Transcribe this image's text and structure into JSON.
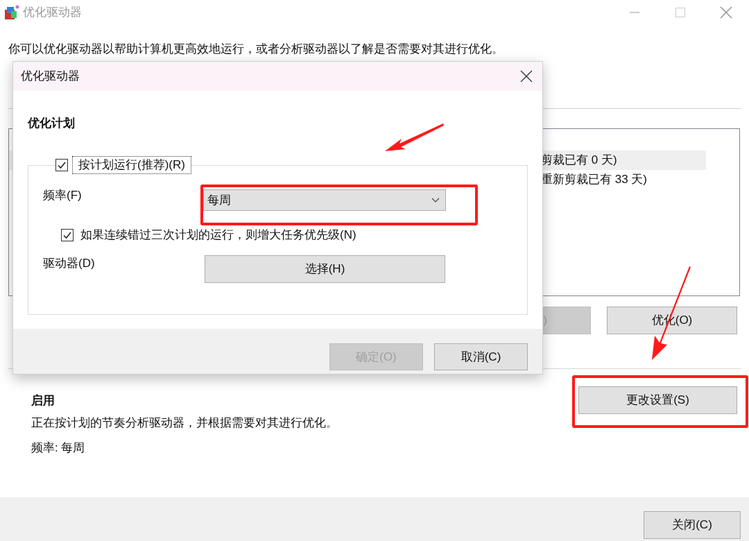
{
  "window": {
    "title": "优化驱动器",
    "description": "你可以优化驱动器以帮助计算机更高效地运行，或者分析驱动器以了解是否需要对其进行优化。"
  },
  "drive_list": {
    "rows": [
      {
        "text": "剪裁已有 0 天)",
        "selected": true
      },
      {
        "text": "重新剪裁已有 33 天)",
        "selected": false
      }
    ]
  },
  "drive_buttons": [
    {
      "label": ")",
      "disabled": true
    },
    {
      "label": "优化(O)",
      "disabled": false
    }
  ],
  "scheduled_optimization": {
    "status": "启用",
    "description": "正在按计划的节奏分析驱动器，并根据需要对其进行优化。",
    "frequency": "频率: 每周",
    "button": "更改设置(S)"
  },
  "footer": {
    "close_button": "关闭(C)"
  },
  "dialog": {
    "title": "优化驱动器",
    "heading": "优化计划",
    "run_on_schedule": {
      "label": "按计划运行(推荐)(R)",
      "checked": true
    },
    "frequency_label": "频率(F)",
    "frequency_value": "每周",
    "increase_priority": {
      "label": "如果连续错过三次计划的运行，则增大任务优先级(N)",
      "checked": true
    },
    "drives_label": "驱动器(D)",
    "select_button": "选择(H)",
    "buttons": [
      {
        "label": "确定(O)",
        "disabled": true
      },
      {
        "label": "取消(C)",
        "disabled": false
      }
    ]
  }
}
